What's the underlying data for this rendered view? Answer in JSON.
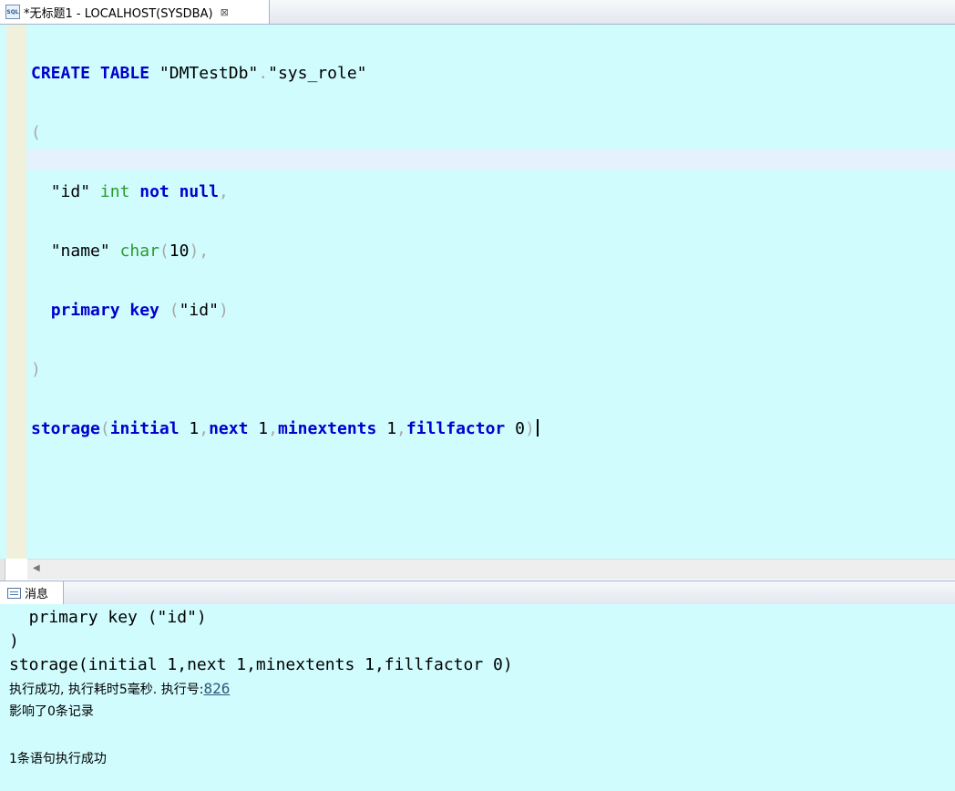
{
  "editor_tab": {
    "icon": "sql-file-icon",
    "icon_text": "SQL",
    "title": "*无标题1 - LOCALHOST(SYSDBA)",
    "close_icon": "close-icon"
  },
  "code": {
    "l1": {
      "create": "CREATE",
      "table": "TABLE",
      "schema": "\"DMTestDb\"",
      "dot": ".",
      "tname": "\"sys_role\""
    },
    "l2": {
      "open": "("
    },
    "l3": {
      "indent": "  ",
      "col": "\"id\"",
      "type": "int",
      "notnull": "not null",
      "comma": ","
    },
    "l4": {
      "indent": "  ",
      "col": "\"name\"",
      "type": "char",
      "open": "(",
      "len": "10",
      "close": ")",
      "comma": ","
    },
    "l5": {
      "indent": "  ",
      "pk": "primary key",
      "open": "(",
      "col": "\"id\"",
      "close": ")"
    },
    "l6": {
      "close": ")"
    },
    "l7": {
      "storage": "storage",
      "open": "(",
      "initial": "initial",
      "v1": " 1",
      "c1": ",",
      "next": "next",
      "v2": " 1",
      "c2": ",",
      "minextents": "minextents",
      "v3": " 1",
      "c3": ",",
      "fillfactor": "fillfactor",
      "v4": " 0",
      "close": ")"
    }
  },
  "hscroll": {
    "left_icon": "scroll-left-icon"
  },
  "messages_tab": {
    "icon": "message-icon",
    "label": "消息"
  },
  "messages": {
    "line1": "  primary key (\"id\")",
    "line2": ")",
    "line3": "storage(initial 1,next 1,minextents 1,fillfactor 0)",
    "exec_text": "执行成功, 执行耗时5毫秒. 执行号:",
    "exec_id": "826",
    "affected": "影响了0条记录",
    "summary": "1条语句执行成功"
  },
  "colors": {
    "editor_bg": "#d0fcfe",
    "keyword": "#0000cc",
    "type": "#2a9a2a",
    "punct": "#a8a8a8",
    "current_line": "#e5f2fd",
    "gutter": "#f0f0dc"
  }
}
